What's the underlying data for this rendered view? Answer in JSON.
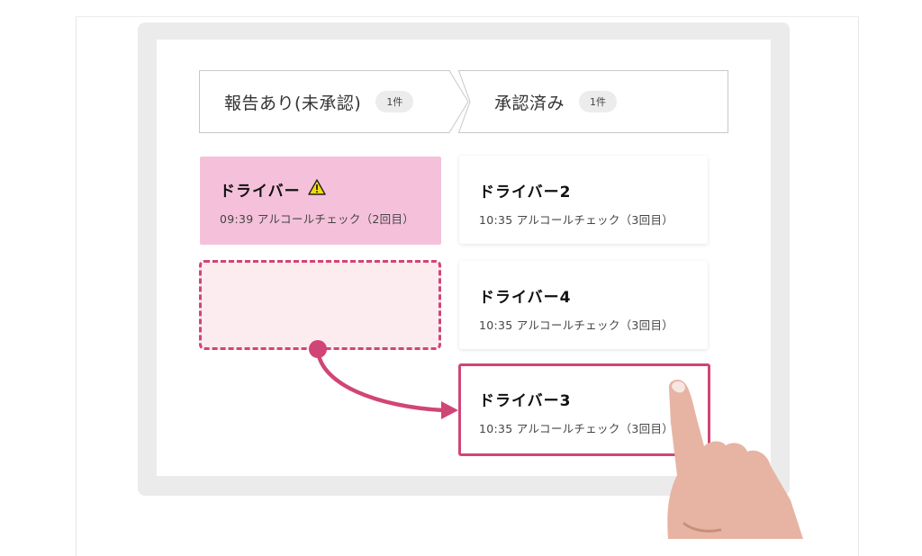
{
  "steps": [
    {
      "label": "報告あり(未承認)",
      "badge": "1件"
    },
    {
      "label": "承認済み",
      "badge": "1件"
    }
  ],
  "cards": {
    "pending": {
      "name": "ドライバー",
      "detail": "09:39 アルコールチェック（2回目）"
    },
    "driver2": {
      "name": "ドライバー2",
      "detail": "10:35 アルコールチェック（3回目）"
    },
    "driver4": {
      "name": "ドライバー4",
      "detail": "10:35 アルコールチェック（3回目）"
    },
    "driver3": {
      "name": "ドライバー3",
      "detail": "10:35 アルコールチェック（3回目）"
    }
  },
  "icons": {
    "warning": "warning-icon",
    "arrow": "drag-arrow-icon",
    "hand": "pointing-hand-icon"
  },
  "colors": {
    "accent": "#d14576",
    "pending_card": "#f5c1da",
    "placeholder_fill": "#fcecef",
    "warning": "#f5d90f"
  }
}
